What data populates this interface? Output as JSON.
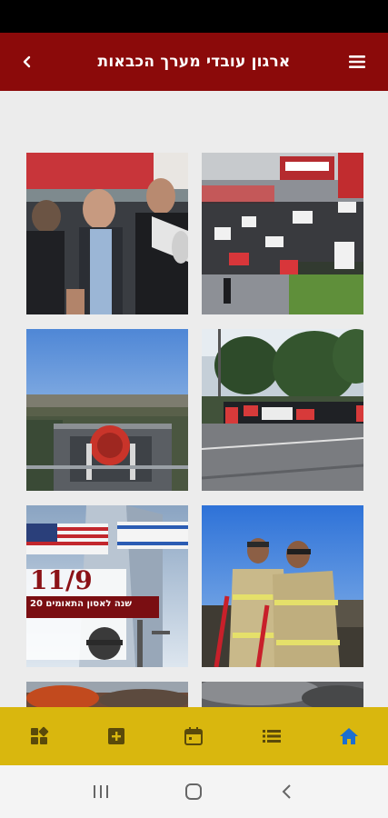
{
  "header": {
    "title": "ארגון עובדי מערך הכבאות",
    "back_icon": "chevron-left-icon",
    "menu_icon": "hamburger-menu-icon",
    "bg_color": "#8b0a0a"
  },
  "gallery": {
    "tiles": [
      {
        "name": "photo-protest-megaphone"
      },
      {
        "name": "photo-firefighters-sit-in"
      },
      {
        "name": "photo-rooftop-siren"
      },
      {
        "name": "photo-roadside-protest"
      },
      {
        "name": "photo-9-11-memorial",
        "date_text": "11/9",
        "caption": "20 שנה לאסון התאומים"
      },
      {
        "name": "photo-two-firefighters"
      },
      {
        "name": "photo-partial-fire"
      },
      {
        "name": "photo-partial-smoke"
      }
    ]
  },
  "bottom_nav": {
    "bg_color": "#d9b70e",
    "items": [
      {
        "icon": "grid-icon",
        "active": false
      },
      {
        "icon": "add-box-icon",
        "active": false
      },
      {
        "icon": "calendar-icon",
        "active": false
      },
      {
        "icon": "list-icon",
        "active": false
      },
      {
        "icon": "home-icon",
        "active": true
      }
    ]
  },
  "system_nav": {
    "items": [
      "recent-apps-icon",
      "home-circle-icon",
      "back-arrow-icon"
    ]
  }
}
